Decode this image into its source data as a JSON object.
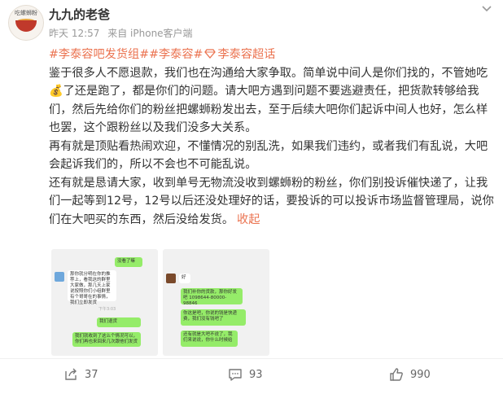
{
  "post": {
    "username": "九九的老爸",
    "time": "昨天 12:57",
    "source": "来自 iPhone客户端",
    "avatar_text": "吃螺蛳粉",
    "topics": [
      "#李泰容吧发货组#",
      "#李泰容#",
      "李泰容超话"
    ],
    "paragraphs": [
      [
        "鉴于很多人不愿退款，我们也在沟通给大家争取。简单说中间人是你们找的，不管她吃",
        "了还是跑了，都是你们的问题。请大吧方遇到问题不要逃避责任，把货款转够给我们，然后先给你们的粉丝把螺蛳粉发出去，至于后续大吧你们起诉中间人也好，怎么样也罢，这个跟粉丝以及我们没多大关系。"
      ],
      "再有就是顶贴看热闹欢迎，不懂情况的别乱洗，如果我们违约，或者我们有乱说，大吧会起诉我们的，所以不会也不可能乱说。",
      "还有就是恳请大家，收到单号无物流没收到螺蛳粉的粉丝，你们别投诉催快递了，让我们一起等到12号，12号以后还没处理好的话，要投诉的可以投诉市场监督管理局，说你们在大吧买的东西，然后没给发货。"
    ],
    "collapse_label": "收起",
    "emoji": "💰"
  },
  "images": {
    "left": {
      "bubbles": [
        "没看了嘛",
        "那你就分明在你的推荐上，看我这的群里大家做，那几天上家说按照你们小组群里有个哥哥在的事情，我们立即发货",
        "我们退货",
        "那就，退好再要快了，你们等单号出来",
        "我们就收到了这么个情况可以，你们再也来回来几次跟他们发货"
      ],
      "timestamp": "下午3:03"
    },
    "right": {
      "bubbles": [
        "好",
        "我们补你的货款，那你好发吧 1098644-80000-98846",
        "你这是吧，你说的钱是快递费，我们没有钱吧了",
        "还有就是大吧不说了，我们来说说，你什么时候给"
      ]
    }
  },
  "footer": {
    "share_count": "37",
    "comment_count": "93",
    "like_count": "990"
  }
}
